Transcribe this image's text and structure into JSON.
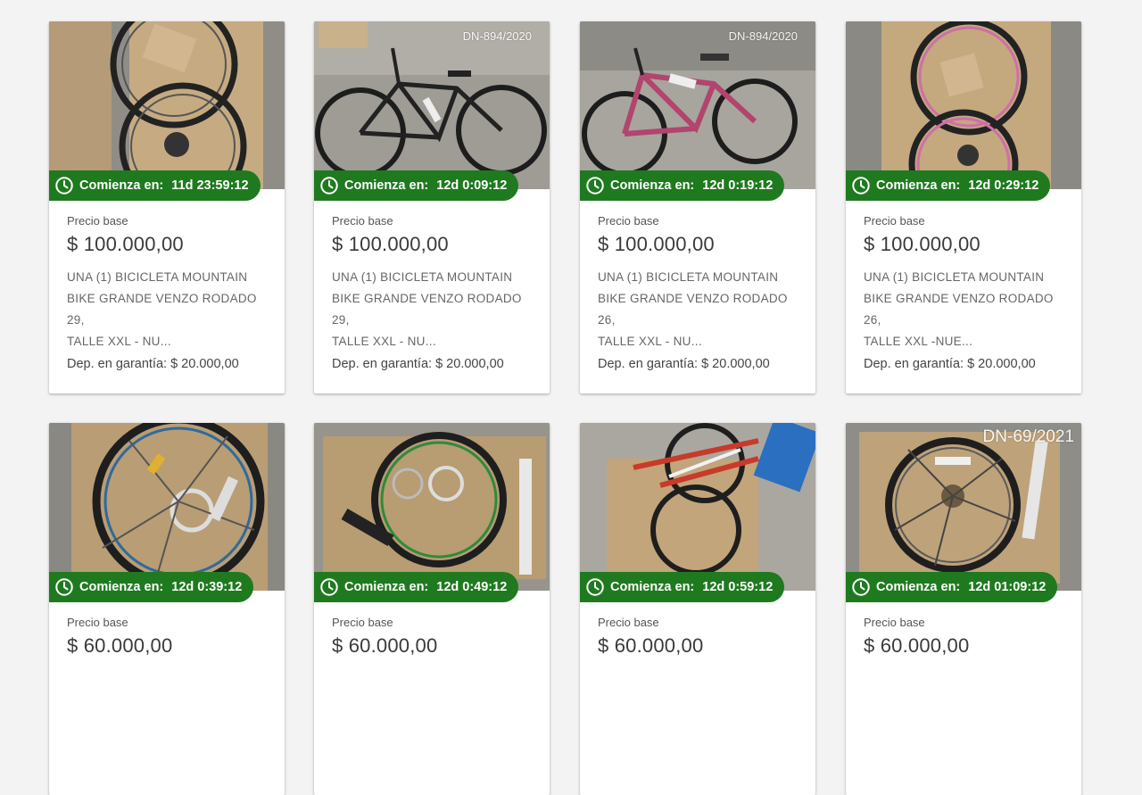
{
  "labels": {
    "starts_in": "Comienza en:",
    "base_price": "Precio base",
    "deposit": "Dep. en garantía:"
  },
  "icons": {
    "clock": "clock-icon"
  },
  "colors": {
    "badge": "#1f7a1f"
  },
  "lots": [
    {
      "ref": "",
      "countdown": "11d 23:59:12",
      "price": "$ 100.000,00",
      "desc": [
        "UNA (1) BICICLETA MOUNTAIN",
        "BIKE GRANDE VENZO RODADO 29,",
        "TALLE XXL - NU..."
      ],
      "deposit": "$ 20.000,00"
    },
    {
      "ref": "DN-894/2020",
      "countdown": "12d 0:09:12",
      "price": "$ 100.000,00",
      "desc": [
        "UNA (1) BICICLETA MOUNTAIN",
        "BIKE GRANDE VENZO RODADO 29,",
        "TALLE XXL - NU..."
      ],
      "deposit": "$ 20.000,00"
    },
    {
      "ref": "DN-894/2020",
      "countdown": "12d 0:19:12",
      "price": "$ 100.000,00",
      "desc": [
        "UNA (1) BICICLETA MOUNTAIN",
        "BIKE GRANDE VENZO RODADO 26,",
        "TALLE XXL - NU..."
      ],
      "deposit": "$ 20.000,00"
    },
    {
      "ref": "",
      "countdown": "12d 0:29:12",
      "price": "$ 100.000,00",
      "desc": [
        "UNA (1) BICICLETA MOUNTAIN",
        "BIKE GRANDE VENZO RODADO 26,",
        "TALLE XXL -NUE..."
      ],
      "deposit": "$ 20.000,00"
    },
    {
      "ref": "",
      "countdown": "12d 0:39:12",
      "price": "$ 60.000,00",
      "desc": [],
      "deposit": ""
    },
    {
      "ref": "",
      "countdown": "12d 0:49:12",
      "price": "$ 60.000,00",
      "desc": [],
      "deposit": ""
    },
    {
      "ref": "",
      "countdown": "12d 0:59:12",
      "price": "$ 60.000,00",
      "desc": [],
      "deposit": ""
    },
    {
      "ref": "DN-69/2021",
      "countdown": "12d 01:09:12",
      "price": "$ 60.000,00",
      "desc": [],
      "deposit": ""
    }
  ]
}
